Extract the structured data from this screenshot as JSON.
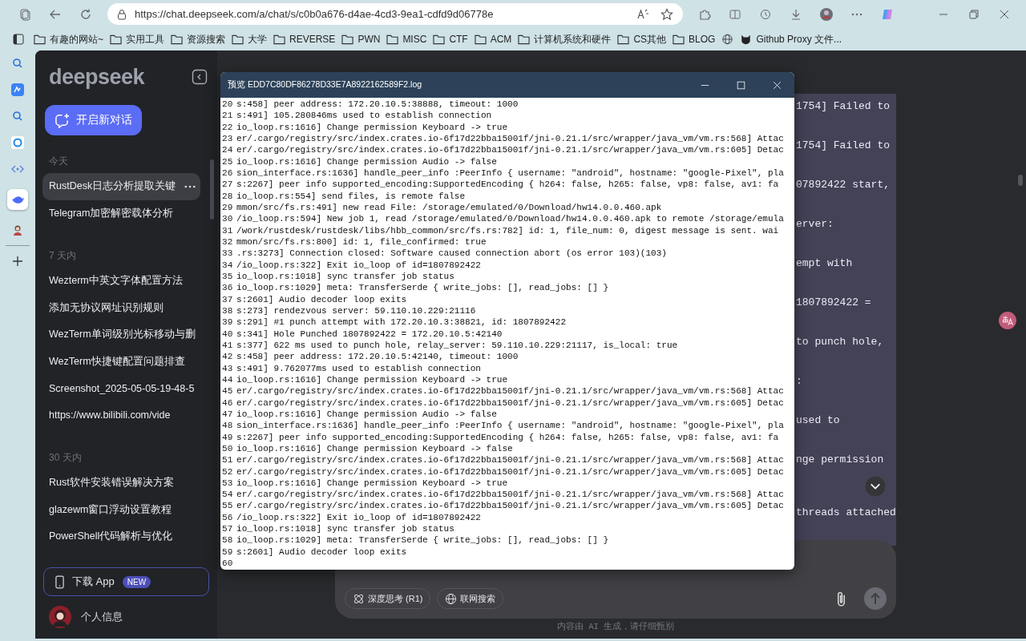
{
  "browser": {
    "url": "https://chat.deepseek.com/a/chat/s/c0b0a676-d4ae-4cd3-9ea1-cdfd9d06778e",
    "bookmarks": [
      {
        "label": "有趣的网站~",
        "kind": "folder"
      },
      {
        "label": "实用工具",
        "kind": "folder"
      },
      {
        "label": "资源搜索",
        "kind": "folder"
      },
      {
        "label": "大学",
        "kind": "folder"
      },
      {
        "label": "REVERSE",
        "kind": "folder"
      },
      {
        "label": "PWN",
        "kind": "folder"
      },
      {
        "label": "MISC",
        "kind": "folder"
      },
      {
        "label": "CTF",
        "kind": "folder"
      },
      {
        "label": "ACM",
        "kind": "folder"
      },
      {
        "label": "计算机系统和硬件",
        "kind": "folder"
      },
      {
        "label": "CS其他",
        "kind": "folder"
      },
      {
        "label": "BLOG",
        "kind": "folder"
      },
      {
        "kind": "globe"
      },
      {
        "label": "Github Proxy 文件...",
        "kind": "cat"
      }
    ]
  },
  "sidebar": {
    "logo": "deepseek",
    "new_chat": "开启新对话",
    "sections": [
      {
        "label": "今天",
        "items": [
          {
            "title": "RustDesk日志分析提取关键",
            "selected": true
          },
          {
            "title": "Telegram加密解密载体分析",
            "selected": false
          }
        ]
      },
      {
        "label": "7 天内",
        "items": [
          {
            "title": "Wezterm中英文字体配置方法",
            "selected": false
          },
          {
            "title": "添加无协议网址识别规则",
            "selected": false
          },
          {
            "title": "WezTerm单词级别光标移动与删",
            "selected": false
          },
          {
            "title": "WezTerm快捷键配置问题排查",
            "selected": false
          },
          {
            "title": "Screenshot_2025-05-05-19-48-5",
            "selected": false
          },
          {
            "title": "https://www.bilibili.com/vide",
            "selected": false
          }
        ]
      },
      {
        "label": "30 天内",
        "items": [
          {
            "title": "Rust软件安装错误解决方案",
            "selected": false
          },
          {
            "title": "glazewm窗口浮动设置教程",
            "selected": false
          },
          {
            "title": "PowerShell代码解析与优化",
            "selected": false
          }
        ]
      }
    ],
    "download": {
      "label": "下载 App",
      "badge": "NEW"
    },
    "profile": "个人信息"
  },
  "chat": {
    "fragments": [
      "1754] Failed to",
      "1754] Failed to",
      "07892422 start,",
      "erver:",
      "empt with",
      "1807892422 =",
      "to punch hole,",
      ":",
      "used to",
      "nge permission",
      "threads attached"
    ],
    "composer": {
      "deep_think": {
        "label": "深度思考 (R1)",
        "on": false
      },
      "web_search": {
        "label": "联网搜索",
        "on": false
      },
      "send_disabled": true
    },
    "disclaimer": "内容由 AI 生成，请仔细甄别"
  },
  "preview": {
    "title": "预览 EDD7C80DF86278D33E7A8922162589F2.log",
    "lines": [
      {
        "number": "20",
        "text": "s:458] peer address: 172.20.10.5:38888, timeout: 1000"
      },
      {
        "number": "21",
        "text": "s:491] 105.280846ms used to establish connection"
      },
      {
        "number": "22",
        "text": "io_loop.rs:1616] Change permission Keyboard -> true"
      },
      {
        "number": "23",
        "text": "er/.cargo/registry/src/index.crates.io-6f17d22bba15001f/jni-0.21.1/src/wrapper/java_vm/vm.rs:568] Attac"
      },
      {
        "number": "24",
        "text": "er/.cargo/registry/src/index.crates.io-6f17d22bba15001f/jni-0.21.1/src/wrapper/java_vm/vm.rs:605] Detac"
      },
      {
        "number": "25",
        "text": "io_loop.rs:1616] Change permission Audio -> false"
      },
      {
        "number": "26",
        "text": "sion_interface.rs:1636] handle_peer_info :PeerInfo { username: \"android\", hostname: \"google-Pixel\", pla"
      },
      {
        "number": "27",
        "text": "s:2267] peer info supported_encoding:SupportedEncoding { h264: false, h265: false, vp8: false, av1: fa"
      },
      {
        "number": "28",
        "text": "io_loop.rs:554] send files, is remote false"
      },
      {
        "number": "29",
        "text": "mmon/src/fs.rs:491] new read File: /storage/emulated/0/Download/hw14.0.0.460.apk"
      },
      {
        "number": "30",
        "text": "/io_loop.rs:594] New job 1, read /storage/emulated/0/Download/hw14.0.0.460.apk to remote /storage/emula"
      },
      {
        "number": "31",
        "text": "/work/rustdesk/rustdesk/libs/hbb_common/src/fs.rs:782] id: 1, file_num: 0, digest message is sent. wai"
      },
      {
        "number": "32",
        "text": "mmon/src/fs.rs:800] id: 1, file_confirmed: true"
      },
      {
        "number": "33",
        "text": ".rs:3273] Connection closed: Software caused connection abort (os error 103)(103)"
      },
      {
        "number": "34",
        "text": "/io_loop.rs:322] Exit io_loop of id=1807892422"
      },
      {
        "number": "35",
        "text": "io_loop.rs:1018] sync transfer job status"
      },
      {
        "number": "36",
        "text": "io_loop.rs:1029] meta: TransferSerde { write_jobs: [], read_jobs: [] }"
      },
      {
        "number": "37",
        "text": "s:2601] Audio decoder loop exits"
      },
      {
        "number": "38",
        "text": "s:273] rendezvous server: 59.110.10.229:21116"
      },
      {
        "number": "39",
        "text": "s:291] #1 punch attempt with 172.20.10.3:38821, id: 1807892422"
      },
      {
        "number": "40",
        "text": "s:341] Hole Punched 1807892422 = 172.20.10.5:42140"
      },
      {
        "number": "41",
        "text": "s:377] 622 ms used to punch hole, relay_server: 59.110.10.229:21117, is_local: true"
      },
      {
        "number": "42",
        "text": "s:458] peer address: 172.20.10.5:42140, timeout: 1000"
      },
      {
        "number": "43",
        "text": "s:491] 9.762077ms used to establish connection"
      },
      {
        "number": "44",
        "text": "io_loop.rs:1616] Change permission Keyboard -> true"
      },
      {
        "number": "45",
        "text": "er/.cargo/registry/src/index.crates.io-6f17d22bba15001f/jni-0.21.1/src/wrapper/java_vm/vm.rs:568] Attac"
      },
      {
        "number": "46",
        "text": "er/.cargo/registry/src/index.crates.io-6f17d22bba15001f/jni-0.21.1/src/wrapper/java_vm/vm.rs:605] Detac"
      },
      {
        "number": "47",
        "text": "io_loop.rs:1616] Change permission Audio -> false"
      },
      {
        "number": "48",
        "text": "sion_interface.rs:1636] handle_peer_info :PeerInfo { username: \"android\", hostname: \"google-Pixel\", pla"
      },
      {
        "number": "49",
        "text": "s:2267] peer info supported_encoding:SupportedEncoding { h264: false, h265: false, vp8: false, av1: fa"
      },
      {
        "number": "50",
        "text": "io_loop.rs:1616] Change permission Keyboard -> false"
      },
      {
        "number": "51",
        "text": "er/.cargo/registry/src/index.crates.io-6f17d22bba15001f/jni-0.21.1/src/wrapper/java_vm/vm.rs:568] Attac"
      },
      {
        "number": "52",
        "text": "er/.cargo/registry/src/index.crates.io-6f17d22bba15001f/jni-0.21.1/src/wrapper/java_vm/vm.rs:605] Detac"
      },
      {
        "number": "53",
        "text": "io_loop.rs:1616] Change permission Keyboard -> true"
      },
      {
        "number": "54",
        "text": "er/.cargo/registry/src/index.crates.io-6f17d22bba15001f/jni-0.21.1/src/wrapper/java_vm/vm.rs:568] Attac"
      },
      {
        "number": "55",
        "text": "er/.cargo/registry/src/index.crates.io-6f17d22bba15001f/jni-0.21.1/src/wrapper/java_vm/vm.rs:605] Detac"
      },
      {
        "number": "56",
        "text": "/io_loop.rs:322] Exit io_loop of id=1807892422"
      },
      {
        "number": "57",
        "text": "io_loop.rs:1018] sync transfer job status"
      },
      {
        "number": "58",
        "text": "io_loop.rs:1029] meta: TransferSerde { write_jobs: [], read_jobs: [] }"
      },
      {
        "number": "59",
        "text": "s:2601] Audio decoder loop exits"
      },
      {
        "number": "60"
      }
    ]
  }
}
